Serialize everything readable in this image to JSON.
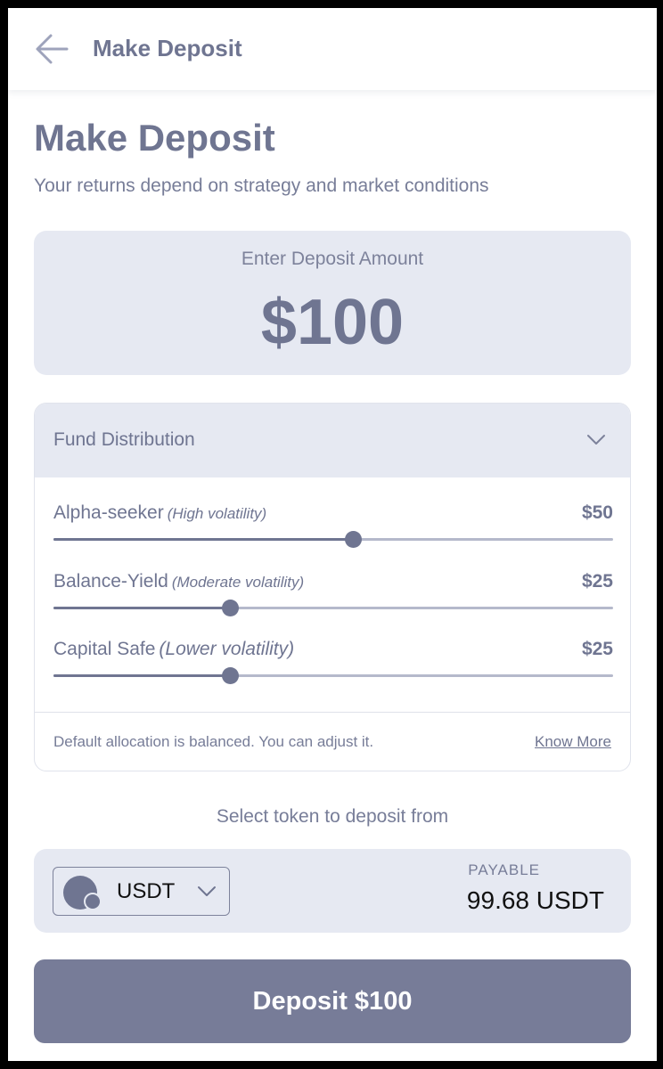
{
  "appbar": {
    "title": "Make Deposit",
    "back_icon": "arrow-left-icon"
  },
  "page": {
    "title": "Make Deposit",
    "subtitle": "Your returns depend on strategy and market conditions"
  },
  "amount": {
    "label": "Enter Deposit Amount",
    "value": "$100"
  },
  "distribution": {
    "title": "Fund Distribution",
    "toggle_icon": "chevron-down-icon",
    "allocations": [
      {
        "name": "Alpha-seeker",
        "note": "(High volatility)",
        "value": "$50",
        "fraction": 0.535
      },
      {
        "name": "Balance-Yield",
        "note": "(Moderate volatility)",
        "value": "$25",
        "fraction": 0.315
      },
      {
        "name": "Capital Safe",
        "note": "(Lower volatility)",
        "value": "$25",
        "fraction": 0.315
      }
    ],
    "footnote": "Default allocation is balanced. You can adjust it.",
    "know_more": "Know More"
  },
  "token": {
    "select_label": "Select token to deposit from",
    "selected": "USDT",
    "coin_icon": "token-coin-icon",
    "dropdown_icon": "chevron-down-icon",
    "payable_label": "PAYABLE",
    "payable_value": "99.68 USDT"
  },
  "action": {
    "deposit_label": "Deposit $100"
  },
  "colors": {
    "accent": "#6f7591",
    "card_bg": "#e6e9f2",
    "button_bg": "#777c98",
    "track": "#b5b9cb"
  }
}
